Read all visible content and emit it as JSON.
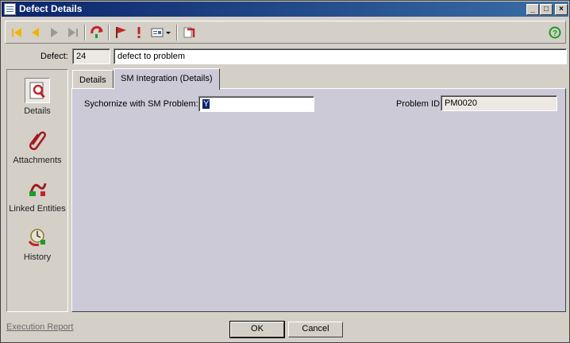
{
  "window": {
    "title": "Defect Details",
    "controls": {
      "minimize": "_",
      "maximize": "□",
      "close": "×"
    }
  },
  "toolbar": {
    "items": [
      {
        "icon": "first-record-icon"
      },
      {
        "icon": "previous-record-icon"
      },
      {
        "icon": "next-record-icon"
      },
      {
        "icon": "last-record-icon"
      },
      {
        "icon": "refresh-icon"
      },
      {
        "icon": "flag-icon"
      },
      {
        "icon": "exclamation-icon"
      },
      {
        "icon": "form-dropdown-icon"
      },
      {
        "icon": "spelling-icon"
      },
      {
        "icon": "help-icon"
      }
    ],
    "colors": {
      "arrow": "#f0b400",
      "arrow_disabled": "#9a9a9a",
      "red": "#c0252d",
      "help": "#1e9a2a"
    }
  },
  "defect": {
    "label": "Defect:",
    "id": "24",
    "summary": "defect to problem"
  },
  "sidenav": {
    "items": [
      {
        "label": "Details",
        "icon": "details-icon"
      },
      {
        "label": "Attachments",
        "icon": "attachments-icon"
      },
      {
        "label": "Linked Entities",
        "icon": "linked-entities-icon"
      },
      {
        "label": "History",
        "icon": "history-icon"
      }
    ]
  },
  "tabs": [
    {
      "label": "Details"
    },
    {
      "label": "SM Integration (Details)"
    }
  ],
  "sm_integration": {
    "sync_label": "Sychornize with SM Problem:",
    "sync_value": "Y",
    "problem_label": "Problem ID:",
    "problem_value": "PM0020"
  },
  "footer": {
    "execution_report": "Execution Report",
    "ok": "OK",
    "cancel": "Cancel"
  }
}
